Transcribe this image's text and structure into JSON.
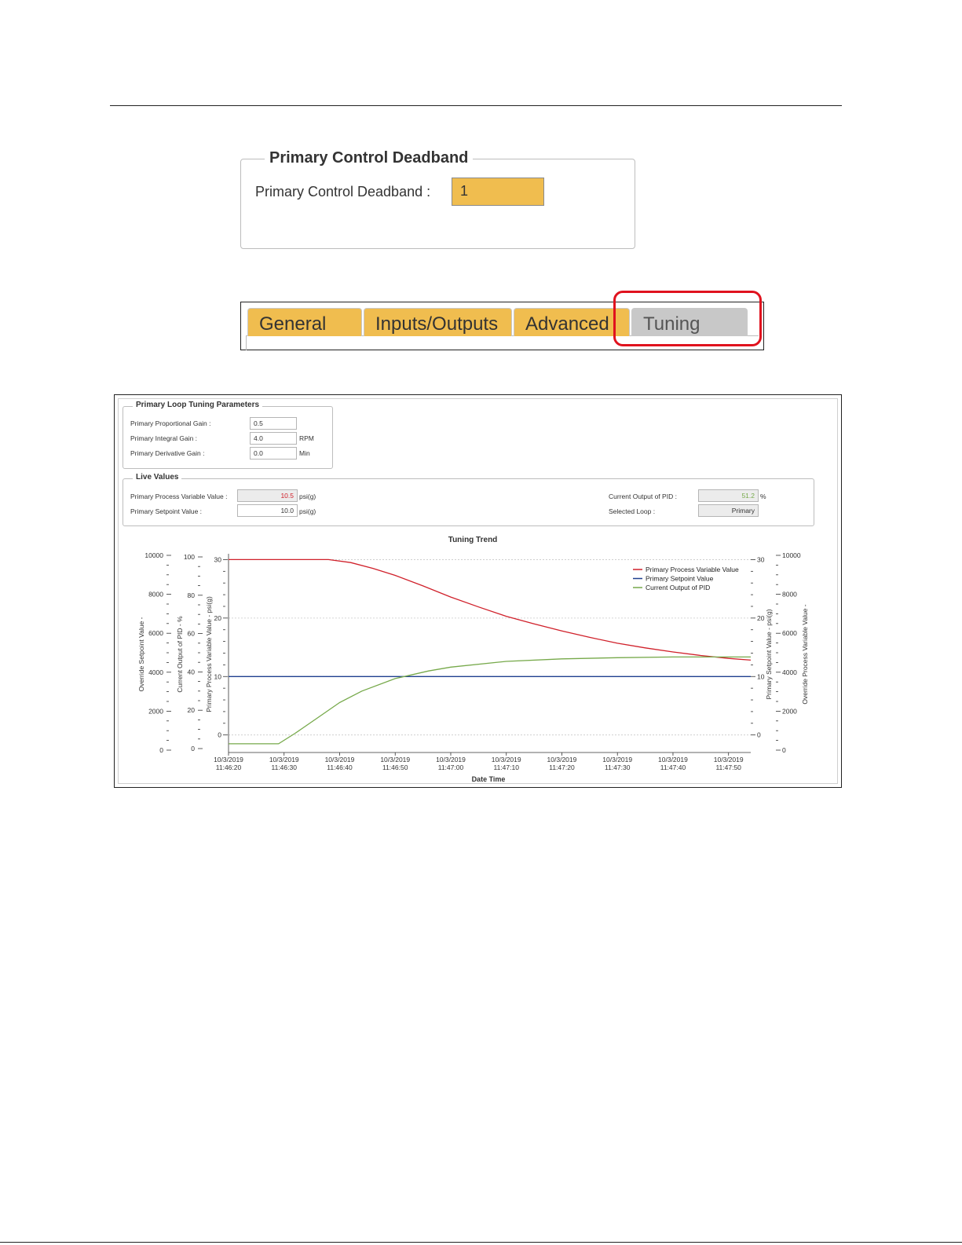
{
  "deadband": {
    "legend": "Primary Control Deadband",
    "label": "Primary Control Deadband :",
    "value": "1"
  },
  "tabs": [
    {
      "label": "General",
      "active": false
    },
    {
      "label": "Inputs/Outputs",
      "active": false
    },
    {
      "label": "Advanced",
      "active": false
    },
    {
      "label": "Tuning",
      "active": true
    }
  ],
  "tuning_params": {
    "legend": "Primary Loop Tuning Parameters",
    "rows": [
      {
        "label": "Primary Proportional Gain :",
        "value": "0.5",
        "unit": ""
      },
      {
        "label": "Primary Integral Gain :",
        "value": "4.0",
        "unit": "RPM"
      },
      {
        "label": "Primary Derivative Gain :",
        "value": "0.0",
        "unit": "Min"
      }
    ]
  },
  "live_values": {
    "legend": "Live Values",
    "pv_label": "Primary Process Variable Value :",
    "pv_value": "10.5",
    "pv_unit": "psi(g)",
    "sp_label": "Primary Setpoint Value :",
    "sp_value": "10.0",
    "sp_unit": "psi(g)",
    "out_label": "Current Output of PID :",
    "out_value": "51.2",
    "out_unit": "%",
    "loop_label": "Selected Loop :",
    "loop_value": "Primary"
  },
  "colors": {
    "accent_tab": "#f0bd4f",
    "highlight": "#e0121e",
    "pv": "#d0202a",
    "sp": "#1f3f8f",
    "out": "#76a94a"
  },
  "chart_data": {
    "type": "line",
    "title": "Tuning Trend",
    "xlabel": "Date Time",
    "x_ticks": [
      [
        "10/3/2019",
        "11:46:20"
      ],
      [
        "10/3/2019",
        "11:46:30"
      ],
      [
        "10/3/2019",
        "11:46:40"
      ],
      [
        "10/3/2019",
        "11:46:50"
      ],
      [
        "10/3/2019",
        "11:47:00"
      ],
      [
        "10/3/2019",
        "11:47:10"
      ],
      [
        "10/3/2019",
        "11:47:20"
      ],
      [
        "10/3/2019",
        "11:47:30"
      ],
      [
        "10/3/2019",
        "11:47:40"
      ],
      [
        "10/3/2019",
        "11:47:50"
      ]
    ],
    "x_times": [
      "11:46:20",
      "11:46:30",
      "11:46:40",
      "11:46:50",
      "11:47:00",
      "11:47:10",
      "11:47:20",
      "11:47:30",
      "11:47:40",
      "11:47:50"
    ],
    "x_range": [
      "11:46:20",
      "11:47:54"
    ],
    "axes": {
      "override_sp": {
        "label": "Override Setpoint Value -",
        "ticks": [
          "0",
          "2000",
          "4000",
          "6000",
          "8000",
          "10000"
        ],
        "range": [
          0,
          10000
        ]
      },
      "output": {
        "label": "Current Output of PID - %",
        "ticks": [
          "0",
          "20",
          "40",
          "60",
          "80",
          "100"
        ],
        "range": [
          0,
          100
        ]
      },
      "pv_left": {
        "label": "Primary Process Variable Value - psi(g)",
        "ticks": [
          "0",
          "10",
          "20",
          "30"
        ],
        "range": [
          -3,
          31
        ]
      },
      "sp_right": {
        "label": "Primary Setpoint Value - psi(g)",
        "ticks": [
          "0",
          "10",
          "20",
          "30"
        ],
        "range": [
          -3,
          31
        ]
      },
      "override_pv": {
        "label": "Override Process Variable Value -",
        "ticks": [
          "0",
          "2000",
          "4000",
          "6000",
          "8000",
          "10000"
        ],
        "range": [
          0,
          10000
        ]
      }
    },
    "series": [
      {
        "name": "Primary Process Variable Value",
        "axis": "pv",
        "points": [
          [
            "11:46:20",
            30
          ],
          [
            "11:46:30",
            30
          ],
          [
            "11:46:38",
            30
          ],
          [
            "11:46:42",
            29.5
          ],
          [
            "11:46:46",
            28.5
          ],
          [
            "11:46:50",
            27.3
          ],
          [
            "11:46:55",
            25.5
          ],
          [
            "11:47:00",
            23.6
          ],
          [
            "11:47:05",
            21.9
          ],
          [
            "11:47:10",
            20.3
          ],
          [
            "11:47:15",
            19.0
          ],
          [
            "11:47:20",
            17.8
          ],
          [
            "11:47:25",
            16.7
          ],
          [
            "11:47:30",
            15.7
          ],
          [
            "11:47:35",
            14.9
          ],
          [
            "11:47:40",
            14.2
          ],
          [
            "11:47:45",
            13.6
          ],
          [
            "11:47:50",
            13.1
          ],
          [
            "11:47:54",
            12.8
          ]
        ]
      },
      {
        "name": "Primary Setpoint Value",
        "axis": "pv",
        "points": [
          [
            "11:46:20",
            10
          ],
          [
            "11:47:54",
            10
          ]
        ]
      },
      {
        "name": "Current Output of PID",
        "axis": "output",
        "points": [
          [
            "11:46:20",
            2.5
          ],
          [
            "11:46:29",
            2.5
          ],
          [
            "11:46:32",
            8
          ],
          [
            "11:46:36",
            16
          ],
          [
            "11:46:40",
            24
          ],
          [
            "11:46:44",
            30
          ],
          [
            "11:46:50",
            36.5
          ],
          [
            "11:46:56",
            40.5
          ],
          [
            "11:47:00",
            42.5
          ],
          [
            "11:47:10",
            45.5
          ],
          [
            "11:47:20",
            46.8
          ],
          [
            "11:47:30",
            47.4
          ],
          [
            "11:47:40",
            47.8
          ],
          [
            "11:47:54",
            47.8
          ]
        ]
      }
    ],
    "legend_position": "top-right",
    "grid": "horizontal dotted"
  }
}
